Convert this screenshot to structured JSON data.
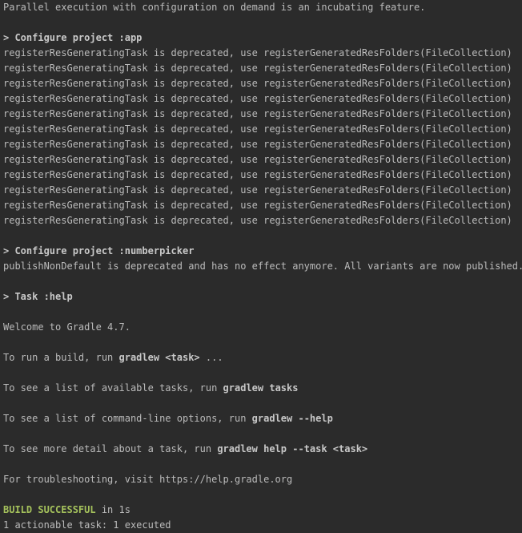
{
  "header_line": "Parallel execution with configuration on demand is an incubating feature.",
  "app_section": {
    "header": "> Configure project :app",
    "lines": [
      "registerResGeneratingTask is deprecated, use registerGeneratedResFolders(FileCollection)",
      "registerResGeneratingTask is deprecated, use registerGeneratedResFolders(FileCollection)",
      "registerResGeneratingTask is deprecated, use registerGeneratedResFolders(FileCollection)",
      "registerResGeneratingTask is deprecated, use registerGeneratedResFolders(FileCollection)",
      "registerResGeneratingTask is deprecated, use registerGeneratedResFolders(FileCollection)",
      "registerResGeneratingTask is deprecated, use registerGeneratedResFolders(FileCollection)",
      "registerResGeneratingTask is deprecated, use registerGeneratedResFolders(FileCollection)",
      "registerResGeneratingTask is deprecated, use registerGeneratedResFolders(FileCollection)",
      "registerResGeneratingTask is deprecated, use registerGeneratedResFolders(FileCollection)",
      "registerResGeneratingTask is deprecated, use registerGeneratedResFolders(FileCollection)",
      "registerResGeneratingTask is deprecated, use registerGeneratedResFolders(FileCollection)",
      "registerResGeneratingTask is deprecated, use registerGeneratedResFolders(FileCollection)"
    ]
  },
  "numberpicker_section": {
    "header": "> Configure project :numberpicker",
    "line": "publishNonDefault is deprecated and has no effect anymore. All variants are now published."
  },
  "task_section": {
    "header": "> Task :help",
    "welcome": "Welcome to Gradle 4.7.",
    "run_build": {
      "prefix": "To run a build, run ",
      "cmd": "gradlew <task>",
      "suffix": " ..."
    },
    "list_tasks": {
      "prefix": "To see a list of available tasks, run ",
      "cmd": "gradlew tasks"
    },
    "cli_options": {
      "prefix": "To see a list of command-line options, run ",
      "cmd": "gradlew --help"
    },
    "task_detail": {
      "prefix": "To see more detail about a task, run ",
      "cmd": "gradlew help --task <task>"
    },
    "troubleshooting": "For troubleshooting, visit https://help.gradle.org"
  },
  "result": {
    "status": "BUILD SUCCESSFUL",
    "duration": " in 1s",
    "summary": "1 actionable task: 1 executed"
  },
  "colors": {
    "background": "#2b2b2b",
    "text": "#bbbbbb",
    "success": "#a5c25c"
  }
}
